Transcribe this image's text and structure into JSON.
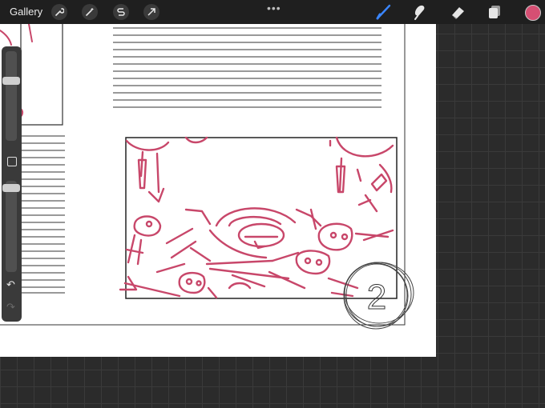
{
  "topbar": {
    "gallery_label": "Gallery",
    "more_label": "•••"
  },
  "tools_left": [
    "wrench-icon",
    "magic-wand-icon",
    "selection-s-icon",
    "transform-arrow-icon"
  ],
  "tools_right": [
    "brush-icon",
    "smudge-icon",
    "eraser-icon",
    "layers-icon"
  ],
  "colors": {
    "active_color": "#d64f73",
    "sketch_color": "#c8476a",
    "brush_accent": "#3a86ff"
  },
  "canvas": {
    "page_number": "2"
  },
  "sidebar": {
    "brush_size_level": 0.35,
    "opacity_level": 0.05,
    "undo_icon": "undo-icon",
    "redo_icon": "redo-icon"
  }
}
